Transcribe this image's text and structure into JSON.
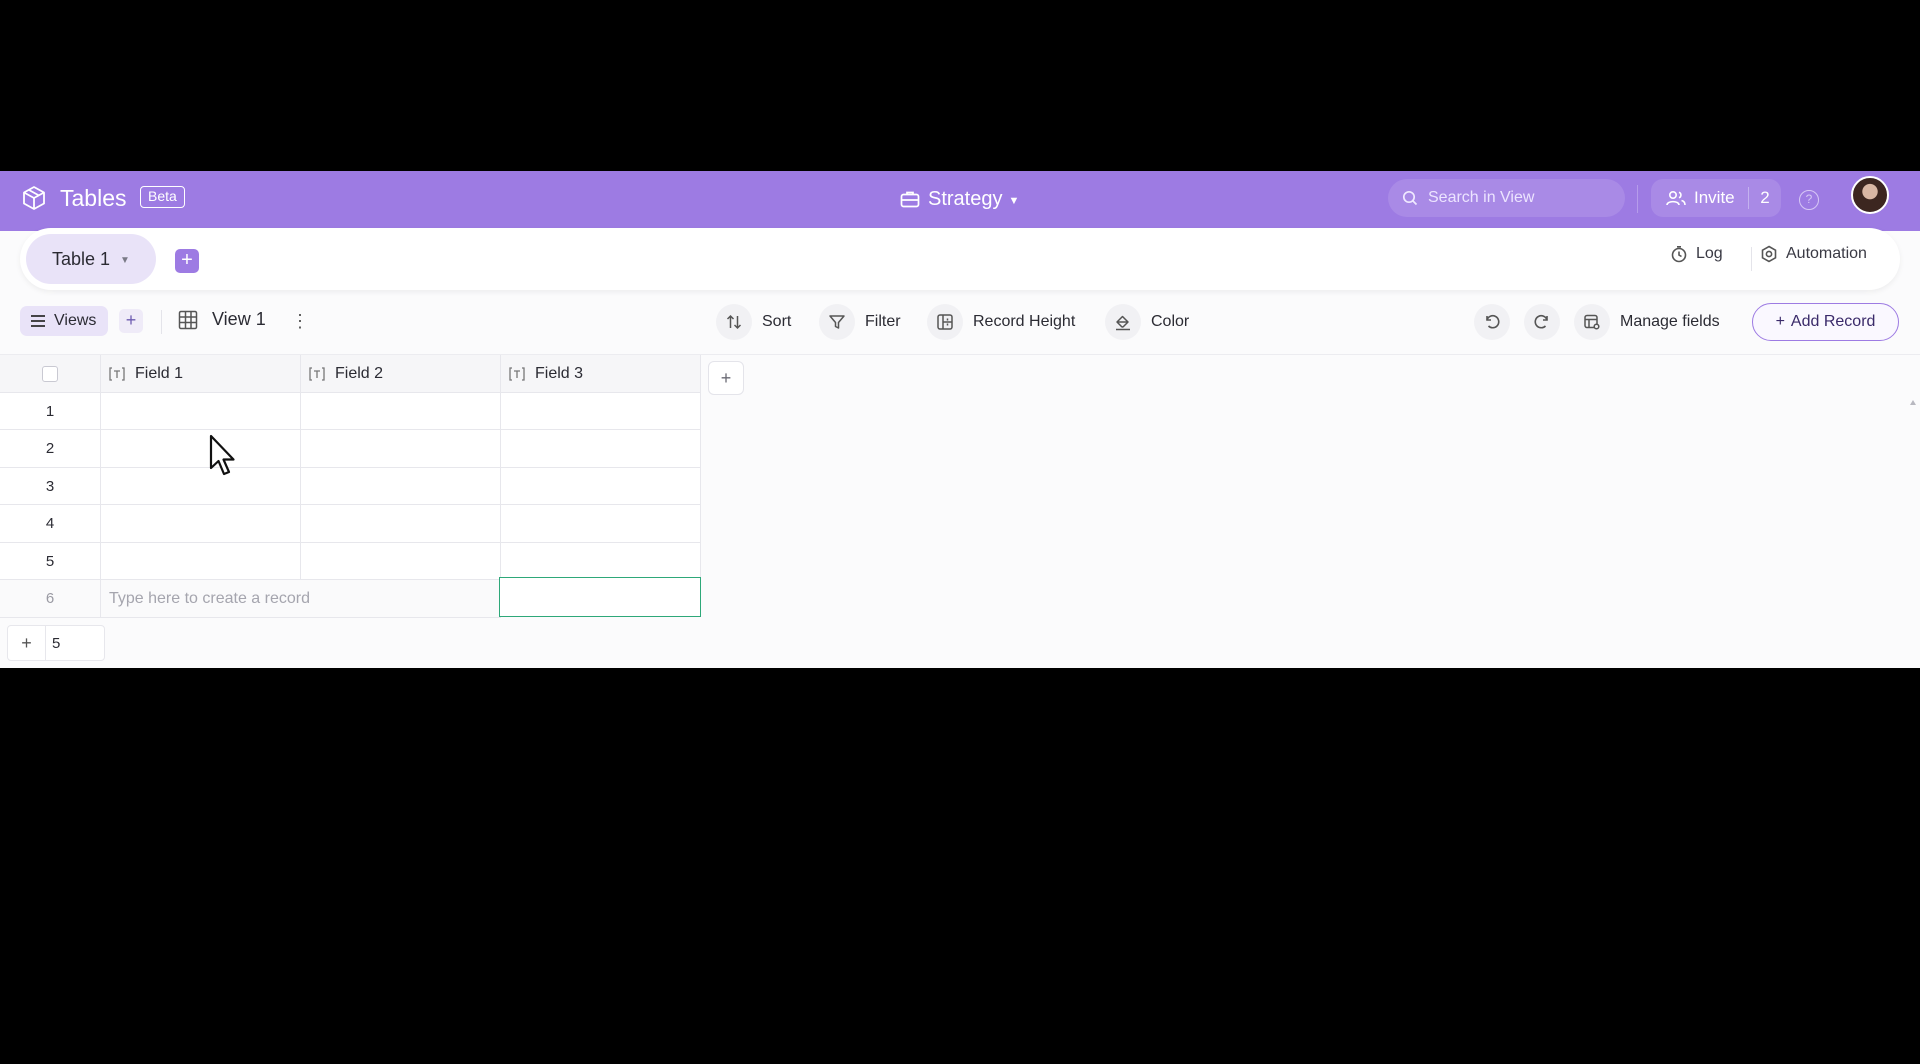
{
  "header": {
    "app_title": "Tables",
    "beta_label": "Beta",
    "workspace_name": "Strategy",
    "search_placeholder": "Search in View",
    "invite_label": "Invite",
    "invite_count": "2",
    "help_glyph": "?"
  },
  "tabs": {
    "active_table": "Table 1",
    "log_label": "Log",
    "automation_label": "Automation"
  },
  "toolbar": {
    "views_label": "Views",
    "view_name": "View 1",
    "sort_label": "Sort",
    "filter_label": "Filter",
    "record_height_label": "Record Height",
    "color_label": "Color",
    "manage_fields_label": "Manage fields",
    "add_record_label": "Add Record"
  },
  "grid": {
    "columns": [
      "Field 1",
      "Field 2",
      "Field 3"
    ],
    "rows": [
      "1",
      "2",
      "3",
      "4",
      "5"
    ],
    "new_row_number": "6",
    "new_row_placeholder": "Type here to create a record",
    "footer_count": "5"
  },
  "colors": {
    "header_bg": "#9d7be3",
    "selected_cell_border": "#2ea879"
  },
  "icons": [
    "cube-logo-icon",
    "briefcase-icon",
    "search-icon",
    "users-icon",
    "help-icon",
    "clock-icon",
    "gear-icon",
    "menu-icon",
    "grid-view-icon",
    "sort-icon",
    "filter-icon",
    "record-height-icon",
    "paint-bucket-icon",
    "undo-icon",
    "redo-icon",
    "manage-fields-icon",
    "text-field-icon",
    "cursor-icon"
  ]
}
